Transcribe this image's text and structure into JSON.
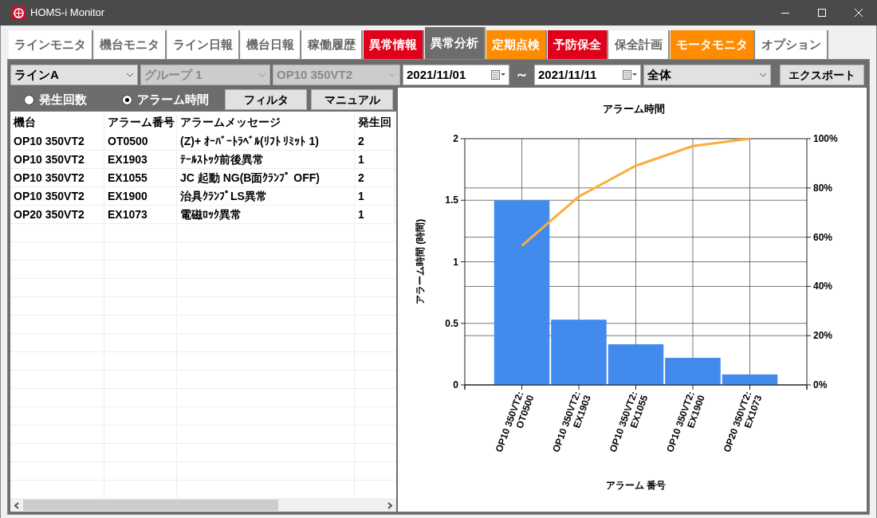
{
  "window": {
    "title": "HOMS-i Monitor"
  },
  "tabs": [
    {
      "label": "ラインモニタ",
      "selected": false,
      "color": "#ffffff"
    },
    {
      "label": "機台モニタ",
      "selected": false,
      "color": "#ffffff"
    },
    {
      "label": "ライン日報",
      "selected": false,
      "color": "#ffffff"
    },
    {
      "label": "機台日報",
      "selected": false,
      "color": "#ffffff"
    },
    {
      "label": "稼働履歴",
      "selected": false,
      "color": "#ffffff"
    },
    {
      "label": "異常情報",
      "selected": false,
      "color": "#e0001b"
    },
    {
      "label": "異常分析",
      "selected": true,
      "color": "#6d6d6d"
    },
    {
      "label": "定期点検",
      "selected": false,
      "color": "#ff8c00"
    },
    {
      "label": "予防保全",
      "selected": false,
      "color": "#e0001b"
    },
    {
      "label": "保全計画",
      "selected": false,
      "color": "#ffffff"
    },
    {
      "label": "モータモニタ",
      "selected": false,
      "color": "#ff8c00"
    },
    {
      "label": "オプション",
      "selected": false,
      "color": "#ffffff"
    }
  ],
  "filters": {
    "line": {
      "value": "ラインA",
      "disabled": false
    },
    "group": {
      "value": "グループ 1",
      "disabled": true
    },
    "machine": {
      "value": "OP10 350VT2",
      "disabled": true
    },
    "date_from": "2021/11/01",
    "range_separator": "～",
    "date_to": "2021/11/11",
    "scope": {
      "value": "全体",
      "disabled": false
    },
    "export_button": "エクスポート"
  },
  "modes": [
    {
      "label": "発生回数",
      "selected": false
    },
    {
      "label": "アラーム時間",
      "selected": true
    }
  ],
  "buttons": [
    "フィルタ",
    "マニュアル"
  ],
  "table": {
    "columns": [
      "機台",
      "アラーム番号",
      "アラームメッセージ",
      "発生回"
    ],
    "rows": [
      [
        "OP10 350VT2",
        "OT0500",
        "(Z)+ ｵｰﾊﾞｰﾄﾗﾍﾞﾙ(ﾘﾌﾄ ﾘﾐｯﾄ 1)",
        "2"
      ],
      [
        "OP10 350VT2",
        "EX1903",
        "ﾃｰﾙｽﾄｯｸ前後異常",
        "1"
      ],
      [
        "OP10 350VT2",
        "EX1055",
        "JC 起動 NG(B面ｸﾗﾝﾌﾟ OFF)",
        "2"
      ],
      [
        "OP10 350VT2",
        "EX1900",
        "治具ｸﾗﾝﾌﾟLS異常",
        "1"
      ],
      [
        "OP20 350VT2",
        "EX1073",
        "電磁ﾛｯｸ異常",
        "1"
      ]
    ]
  },
  "chart": {
    "chart_data": {
      "type": "bar",
      "title": "アラーム時間",
      "xlabel": "アラーム 番号",
      "ylabel": "アラーム時間 (時間)",
      "categories": [
        "OP10 350VT2: OT0500",
        "OP10 350VT2: EX1903",
        "OP10 350VT2: EX1055",
        "OP10 350VT2: EX1900",
        "OP20 350VT2: EX1073"
      ],
      "series": [
        {
          "type": "bar",
          "color": "#428bed",
          "values": [
            1.5,
            0.53,
            0.33,
            0.22,
            0.085
          ]
        },
        {
          "type": "line",
          "axis": "y2",
          "color": "#f9ae3c",
          "values": [
            56.5,
            76.5,
            89,
            97,
            100
          ]
        }
      ],
      "grid": true,
      "ylim": [
        0,
        2
      ],
      "yticks": [
        0,
        0.5,
        1,
        1.5,
        2
      ],
      "y2lim": [
        0,
        100
      ],
      "y2ticks": [
        {
          "value": 0,
          "label": "0%"
        },
        {
          "value": 20,
          "label": "20%"
        },
        {
          "value": 40,
          "label": "40%"
        },
        {
          "value": 60,
          "label": "60%"
        },
        {
          "value": 80,
          "label": "80%"
        },
        {
          "value": 100,
          "label": "100%"
        }
      ]
    }
  }
}
